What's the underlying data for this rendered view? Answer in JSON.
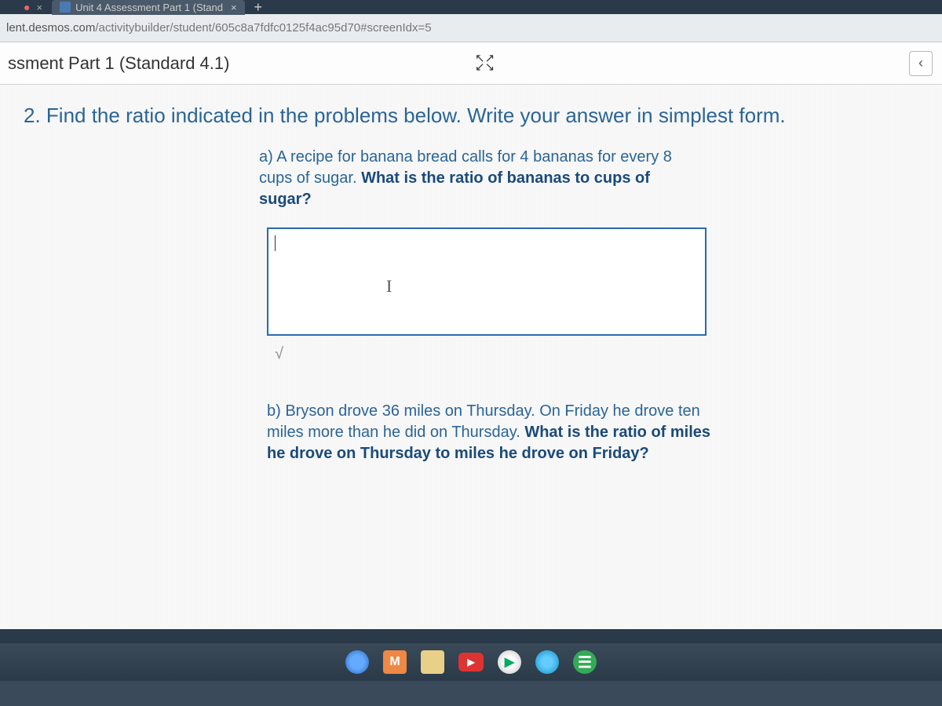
{
  "browser": {
    "tab_title": "Unit 4 Assessment Part 1 (Stand",
    "tab_close": "×",
    "new_tab": "+",
    "close_left": "×",
    "url_host": "lent.desmos.com",
    "url_path": "/activitybuilder/student/605c8a7fdfc0125f4ac95d70#screenIdx=5"
  },
  "header": {
    "title": "ssment Part 1 (Standard 4.1)",
    "expand_top": "⤢",
    "nav_prev": "‹"
  },
  "question": {
    "title": "2. Find the ratio indicated in the problems below. Write your answer in simplest form.",
    "part_a_intro": "a) A recipe for banana bread calls for 4 bananas for every 8 cups of sugar.  ",
    "part_a_bold": "What is the ratio of bananas to cups of sugar?",
    "answer_value": "",
    "caret": "I",
    "sqrt": "√",
    "part_b_intro": "b) Bryson drove 36 miles on Thursday.  On Friday he drove ten miles more than he did on Thursday.  ",
    "part_b_bold": "What is the ratio of miles he drove on Thursday to miles he drove on Friday?"
  },
  "taskbar": {
    "mail": "M",
    "yt": "▶",
    "play": "▶",
    "green": "☰"
  }
}
